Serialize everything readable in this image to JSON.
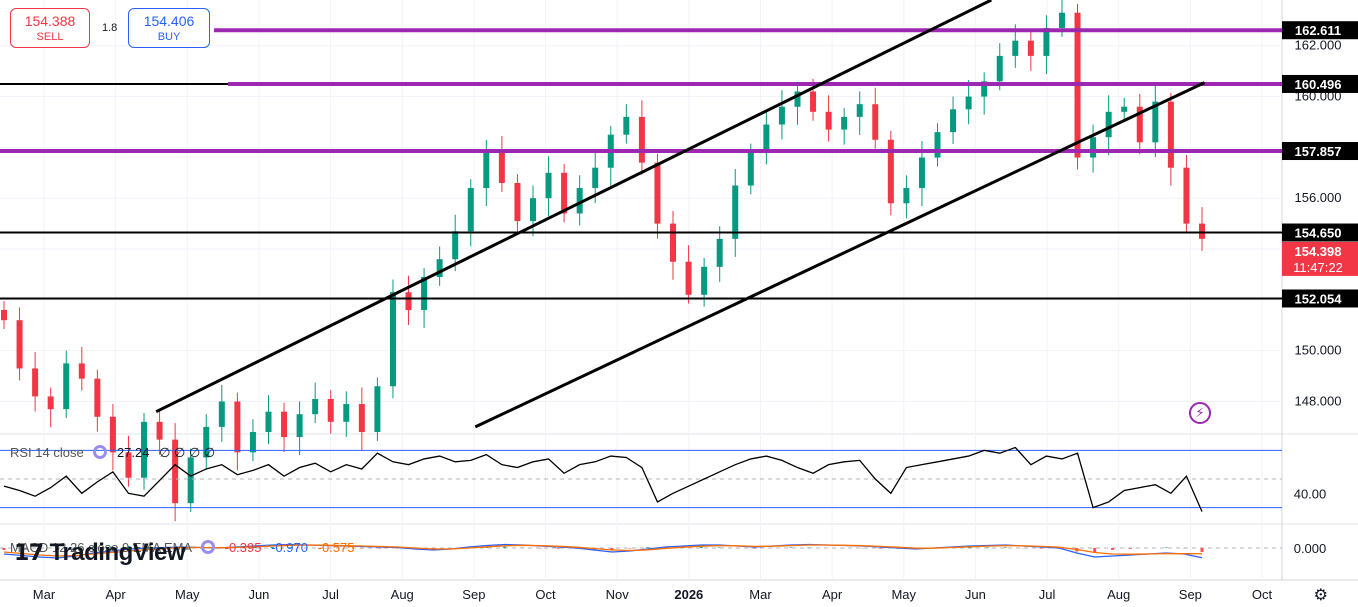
{
  "trade": {
    "sell_price": "154.388",
    "sell_label": "SELL",
    "spread": "1.8",
    "buy_price": "154.406",
    "buy_label": "BUY"
  },
  "rsi_legend": {
    "name": "RSI 14 close",
    "value": "27.24",
    "extra": "∅ ∅ ∅ ∅"
  },
  "macd_legend": {
    "name": "MACD 12 26 close 9 EMA EMA",
    "hist": "-0.395",
    "macd": "-0.970",
    "signal": "-0.575"
  },
  "logo": {
    "text": "TradingView"
  },
  "colors": {
    "up": "#089981",
    "down": "#f23645",
    "purple": "#9c27b0",
    "black": "#000000",
    "rsi_band": "#2962ff",
    "macd_blue": "#2962ff",
    "macd_orange": "#ff6d00"
  },
  "chart_data": {
    "type": "candlestick",
    "panes": [
      "price",
      "rsi",
      "macd"
    ],
    "x_tick_labels": [
      "Mar",
      "Apr",
      "May",
      "Jun",
      "Jul",
      "Aug",
      "Sep",
      "Oct",
      "Nov",
      "2026",
      "Mar",
      "Apr",
      "May",
      "Jun",
      "Jul",
      "Aug",
      "Sep",
      "Oct"
    ],
    "price_axis": {
      "ticks": [
        148.0,
        150.0,
        152.0,
        154.0,
        156.0,
        158.0,
        160.0,
        162.0
      ],
      "tick_labels": [
        "148.000",
        "150.000",
        "156.000",
        "160.000",
        "162.000"
      ],
      "ylim": [
        146.8,
        163.8
      ]
    },
    "price_labels": [
      {
        "value": "162.611",
        "style": "black"
      },
      {
        "value": "160.496",
        "style": "black"
      },
      {
        "value": "157.857",
        "style": "black"
      },
      {
        "value": "154.650",
        "style": "black"
      },
      {
        "value": "154.398",
        "style": "red",
        "countdown": "11:47:22"
      },
      {
        "value": "152.054",
        "style": "black"
      }
    ],
    "horizontal_levels": [
      {
        "price": 162.611,
        "color": "purple"
      },
      {
        "price": 160.496,
        "color": "purple"
      },
      {
        "price": 157.857,
        "color": "purple"
      },
      {
        "price": 154.65,
        "color": "black"
      },
      {
        "price": 152.054,
        "color": "black"
      }
    ],
    "channel_lines": [
      {
        "x_start": 0.115,
        "y_start": 147.6,
        "x_end": 0.73,
        "y_end": 163.8
      },
      {
        "x_start": 0.35,
        "y_start": 147.0,
        "x_end": 0.887,
        "y_end": 160.55
      }
    ],
    "close_series": [
      151.2,
      149.3,
      148.2,
      147.7,
      149.5,
      148.9,
      147.4,
      146.0,
      145.0,
      147.2,
      146.5,
      144.0,
      145.8,
      147.0,
      148.0,
      146.0,
      146.8,
      147.6,
      146.6,
      147.5,
      148.1,
      147.2,
      147.9,
      146.8,
      148.6,
      152.3,
      151.6,
      152.9,
      153.6,
      154.7,
      156.4,
      157.8,
      156.6,
      155.1,
      156.0,
      157.0,
      155.4,
      156.4,
      157.2,
      158.5,
      159.2,
      157.4,
      155.0,
      153.5,
      152.2,
      153.3,
      154.4,
      156.5,
      157.8,
      158.9,
      159.6,
      160.2,
      159.4,
      158.7,
      159.2,
      159.7,
      158.3,
      155.8,
      156.4,
      157.6,
      158.6,
      159.5,
      160.0,
      160.6,
      161.6,
      162.2,
      161.6,
      162.7,
      163.3,
      157.6,
      158.4,
      159.4,
      159.6,
      158.2,
      159.8,
      157.2,
      155.0,
      154.4
    ],
    "rsi": {
      "value": 27.24,
      "bands": [
        70,
        30
      ],
      "mid": 50,
      "tick_labels": [
        "40.00"
      ],
      "series": [
        45,
        42,
        38,
        44,
        52,
        40,
        48,
        55,
        40,
        38,
        49,
        60,
        52,
        57,
        60,
        53,
        56,
        60,
        52,
        58,
        61,
        55,
        60,
        57,
        68,
        62,
        60,
        64,
        66,
        62,
        63,
        67,
        60,
        58,
        62,
        64,
        54,
        60,
        62,
        66,
        65,
        58,
        34,
        40,
        45,
        50,
        55,
        60,
        64,
        66,
        63,
        58,
        54,
        60,
        62,
        63,
        50,
        40,
        58,
        60,
        62,
        64,
        66,
        70,
        68,
        72,
        60,
        66,
        64,
        68,
        30,
        34,
        42,
        44,
        46,
        40,
        52,
        27.24
      ]
    },
    "macd": {
      "hist": -0.395,
      "macd": -0.97,
      "signal": -0.575,
      "tick_labels": [
        "0.000"
      ],
      "series_macd": [
        -0.6,
        -0.75,
        -0.9,
        -1.0,
        -0.8,
        -0.5,
        -0.3,
        -0.1,
        0.0,
        0.05,
        0.1,
        0.05,
        0.0,
        0.1,
        0.2,
        0.3,
        0.35,
        0.3,
        0.25,
        0.2,
        0.15,
        0.1,
        0.05,
        -0.1,
        -0.2,
        -0.1,
        0.1,
        0.25,
        0.35,
        0.3,
        0.2,
        0.1,
        0.0,
        -0.2,
        -0.4,
        -0.3,
        -0.1,
        0.1,
        0.2,
        0.3,
        0.3,
        0.2,
        0.1,
        0.2,
        0.3,
        0.35,
        0.3,
        0.25,
        0.2,
        0.1,
        0.0,
        -0.1,
        0.0,
        0.1,
        0.2,
        0.25,
        0.3,
        0.2,
        0.1,
        0.0,
        -0.5,
        -0.9,
        -0.8,
        -0.7,
        -0.6,
        -0.5,
        -0.6,
        -0.97
      ],
      "series_signal": [
        -0.4,
        -0.55,
        -0.7,
        -0.8,
        -0.75,
        -0.6,
        -0.45,
        -0.3,
        -0.15,
        -0.05,
        0.05,
        0.05,
        0.03,
        0.06,
        0.12,
        0.2,
        0.27,
        0.3,
        0.28,
        0.24,
        0.2,
        0.15,
        0.1,
        0.0,
        -0.1,
        -0.1,
        0.0,
        0.12,
        0.22,
        0.27,
        0.24,
        0.17,
        0.08,
        -0.05,
        -0.2,
        -0.25,
        -0.18,
        -0.03,
        0.08,
        0.18,
        0.24,
        0.22,
        0.16,
        0.18,
        0.24,
        0.3,
        0.3,
        0.27,
        0.23,
        0.16,
        0.08,
        -0.02,
        -0.02,
        0.05,
        0.12,
        0.19,
        0.24,
        0.22,
        0.16,
        0.08,
        -0.15,
        -0.45,
        -0.6,
        -0.62,
        -0.6,
        -0.56,
        -0.57,
        -0.575
      ]
    }
  }
}
